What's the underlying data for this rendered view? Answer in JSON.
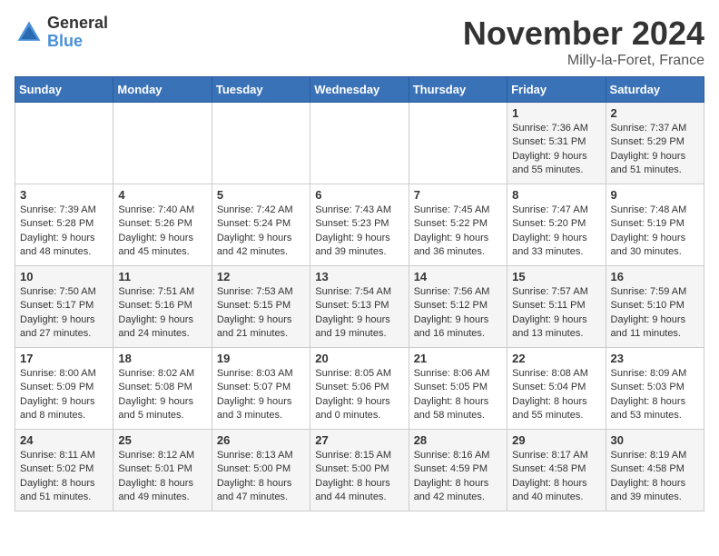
{
  "header": {
    "logo_general": "General",
    "logo_blue": "Blue",
    "month_title": "November 2024",
    "subtitle": "Milly-la-Foret, France"
  },
  "days_of_week": [
    "Sunday",
    "Monday",
    "Tuesday",
    "Wednesday",
    "Thursday",
    "Friday",
    "Saturday"
  ],
  "weeks": [
    [
      {
        "num": "",
        "info": ""
      },
      {
        "num": "",
        "info": ""
      },
      {
        "num": "",
        "info": ""
      },
      {
        "num": "",
        "info": ""
      },
      {
        "num": "",
        "info": ""
      },
      {
        "num": "1",
        "info": "Sunrise: 7:36 AM\nSunset: 5:31 PM\nDaylight: 9 hours\nand 55 minutes."
      },
      {
        "num": "2",
        "info": "Sunrise: 7:37 AM\nSunset: 5:29 PM\nDaylight: 9 hours\nand 51 minutes."
      }
    ],
    [
      {
        "num": "3",
        "info": "Sunrise: 7:39 AM\nSunset: 5:28 PM\nDaylight: 9 hours\nand 48 minutes."
      },
      {
        "num": "4",
        "info": "Sunrise: 7:40 AM\nSunset: 5:26 PM\nDaylight: 9 hours\nand 45 minutes."
      },
      {
        "num": "5",
        "info": "Sunrise: 7:42 AM\nSunset: 5:24 PM\nDaylight: 9 hours\nand 42 minutes."
      },
      {
        "num": "6",
        "info": "Sunrise: 7:43 AM\nSunset: 5:23 PM\nDaylight: 9 hours\nand 39 minutes."
      },
      {
        "num": "7",
        "info": "Sunrise: 7:45 AM\nSunset: 5:22 PM\nDaylight: 9 hours\nand 36 minutes."
      },
      {
        "num": "8",
        "info": "Sunrise: 7:47 AM\nSunset: 5:20 PM\nDaylight: 9 hours\nand 33 minutes."
      },
      {
        "num": "9",
        "info": "Sunrise: 7:48 AM\nSunset: 5:19 PM\nDaylight: 9 hours\nand 30 minutes."
      }
    ],
    [
      {
        "num": "10",
        "info": "Sunrise: 7:50 AM\nSunset: 5:17 PM\nDaylight: 9 hours\nand 27 minutes."
      },
      {
        "num": "11",
        "info": "Sunrise: 7:51 AM\nSunset: 5:16 PM\nDaylight: 9 hours\nand 24 minutes."
      },
      {
        "num": "12",
        "info": "Sunrise: 7:53 AM\nSunset: 5:15 PM\nDaylight: 9 hours\nand 21 minutes."
      },
      {
        "num": "13",
        "info": "Sunrise: 7:54 AM\nSunset: 5:13 PM\nDaylight: 9 hours\nand 19 minutes."
      },
      {
        "num": "14",
        "info": "Sunrise: 7:56 AM\nSunset: 5:12 PM\nDaylight: 9 hours\nand 16 minutes."
      },
      {
        "num": "15",
        "info": "Sunrise: 7:57 AM\nSunset: 5:11 PM\nDaylight: 9 hours\nand 13 minutes."
      },
      {
        "num": "16",
        "info": "Sunrise: 7:59 AM\nSunset: 5:10 PM\nDaylight: 9 hours\nand 11 minutes."
      }
    ],
    [
      {
        "num": "17",
        "info": "Sunrise: 8:00 AM\nSunset: 5:09 PM\nDaylight: 9 hours\nand 8 minutes."
      },
      {
        "num": "18",
        "info": "Sunrise: 8:02 AM\nSunset: 5:08 PM\nDaylight: 9 hours\nand 5 minutes."
      },
      {
        "num": "19",
        "info": "Sunrise: 8:03 AM\nSunset: 5:07 PM\nDaylight: 9 hours\nand 3 minutes."
      },
      {
        "num": "20",
        "info": "Sunrise: 8:05 AM\nSunset: 5:06 PM\nDaylight: 9 hours\nand 0 minutes."
      },
      {
        "num": "21",
        "info": "Sunrise: 8:06 AM\nSunset: 5:05 PM\nDaylight: 8 hours\nand 58 minutes."
      },
      {
        "num": "22",
        "info": "Sunrise: 8:08 AM\nSunset: 5:04 PM\nDaylight: 8 hours\nand 55 minutes."
      },
      {
        "num": "23",
        "info": "Sunrise: 8:09 AM\nSunset: 5:03 PM\nDaylight: 8 hours\nand 53 minutes."
      }
    ],
    [
      {
        "num": "24",
        "info": "Sunrise: 8:11 AM\nSunset: 5:02 PM\nDaylight: 8 hours\nand 51 minutes."
      },
      {
        "num": "25",
        "info": "Sunrise: 8:12 AM\nSunset: 5:01 PM\nDaylight: 8 hours\nand 49 minutes."
      },
      {
        "num": "26",
        "info": "Sunrise: 8:13 AM\nSunset: 5:00 PM\nDaylight: 8 hours\nand 47 minutes."
      },
      {
        "num": "27",
        "info": "Sunrise: 8:15 AM\nSunset: 5:00 PM\nDaylight: 8 hours\nand 44 minutes."
      },
      {
        "num": "28",
        "info": "Sunrise: 8:16 AM\nSunset: 4:59 PM\nDaylight: 8 hours\nand 42 minutes."
      },
      {
        "num": "29",
        "info": "Sunrise: 8:17 AM\nSunset: 4:58 PM\nDaylight: 8 hours\nand 40 minutes."
      },
      {
        "num": "30",
        "info": "Sunrise: 8:19 AM\nSunset: 4:58 PM\nDaylight: 8 hours\nand 39 minutes."
      }
    ]
  ]
}
